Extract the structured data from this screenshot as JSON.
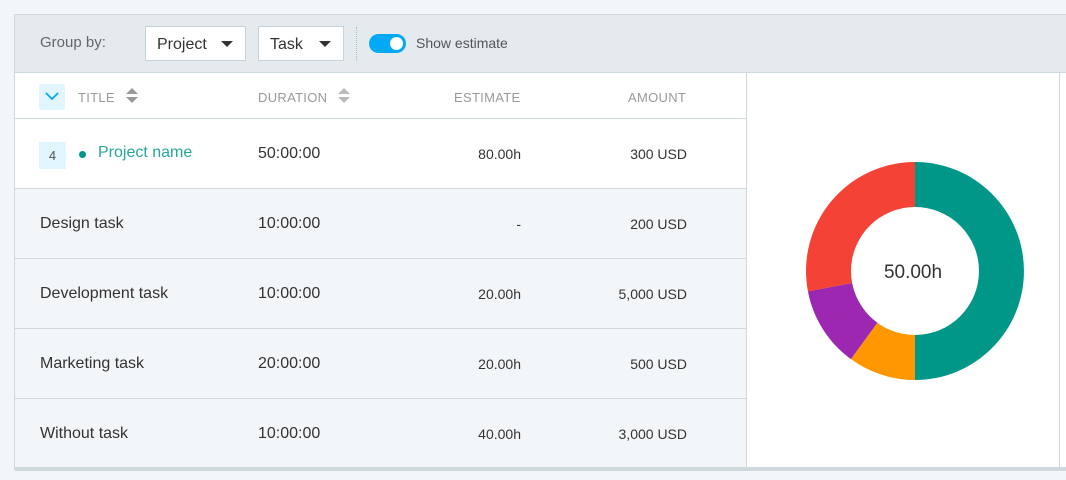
{
  "toolbar": {
    "group_by_label": "Group by:",
    "group1": "Project",
    "group2": "Task",
    "show_estimate_label": "Show estimate",
    "show_estimate_on": true
  },
  "table": {
    "headers": {
      "title": "TITLE",
      "duration": "DURATION",
      "estimate": "ESTIMATE",
      "amount": "AMOUNT"
    },
    "project": {
      "count": "4",
      "name": "Project name",
      "duration": "50:00:00",
      "estimate": "80.00h",
      "amount": "300 USD",
      "dot_color": "#009688"
    },
    "rows": [
      {
        "title": "Design task",
        "duration": "10:00:00",
        "estimate": "-",
        "amount": "200 USD"
      },
      {
        "title": "Development task",
        "duration": "10:00:00",
        "estimate": "20.00h",
        "amount": "5,000 USD"
      },
      {
        "title": "Marketing task",
        "duration": "20:00:00",
        "estimate": "20.00h",
        "amount": "500 USD"
      },
      {
        "title": "Without task",
        "duration": "10:00:00",
        "estimate": "40.00h",
        "amount": "3,000 USD"
      }
    ]
  },
  "chart_data": {
    "type": "pie",
    "center_label": "50.00h",
    "slices": [
      {
        "value": 25,
        "color": "#009688"
      },
      {
        "value": 5,
        "color": "#ff9800"
      },
      {
        "value": 6,
        "color": "#9c27b0"
      },
      {
        "value": 14,
        "color": "#f44336"
      }
    ]
  }
}
